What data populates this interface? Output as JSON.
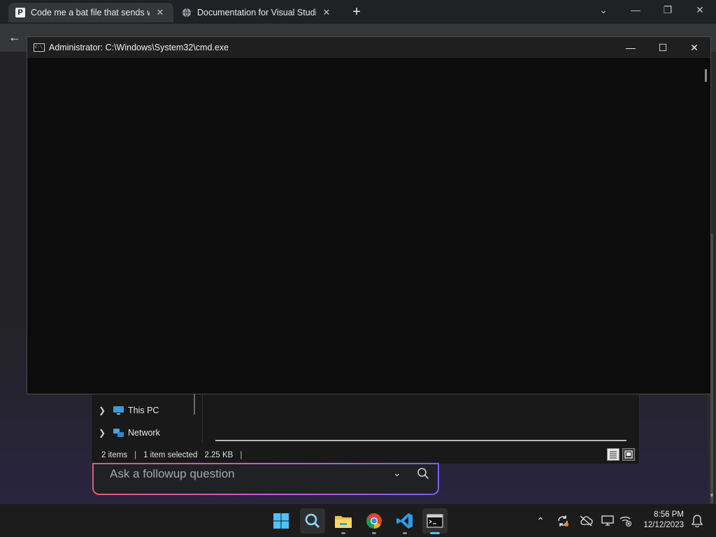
{
  "browser": {
    "tabs": [
      {
        "title": "Code me a bat file that sends wi",
        "favicon": "p-icon",
        "active": true,
        "close": "✕"
      },
      {
        "title": "Documentation for Visual Studio",
        "favicon": "globe-icon",
        "active": false,
        "close": "✕"
      }
    ],
    "new_tab": "+",
    "window_controls": {
      "tablist": "⌄",
      "minimize": "—",
      "restore": "❐",
      "close": "✕"
    }
  },
  "cmd_window": {
    "title": "Administrator: C:\\Windows\\System32\\cmd.exe",
    "icon_text": "C:\\_",
    "controls": {
      "minimize": "—",
      "maximize": "☐",
      "close": "✕"
    }
  },
  "explorer": {
    "nav_items": [
      {
        "label": "This PC",
        "icon": "computer-icon"
      },
      {
        "label": "Network",
        "icon": "network-icon"
      }
    ],
    "status": {
      "items": "2 items",
      "selected": "1 item selected",
      "size": "2.25 KB",
      "separator": "|"
    }
  },
  "followup": {
    "placeholder": "Ask a followup question"
  },
  "taskbar": {
    "apps": [
      "windows-start-icon",
      "search-icon",
      "file-explorer-icon",
      "chrome-icon",
      "vscode-icon",
      "terminal-icon"
    ],
    "clock": {
      "time": "8:56 PM",
      "date": "12/12/2023"
    }
  },
  "colors": {
    "accent_gradient_start": "#e05c6a",
    "accent_gradient_end": "#7c5cf0",
    "console_bg": "#0c0c0c"
  }
}
